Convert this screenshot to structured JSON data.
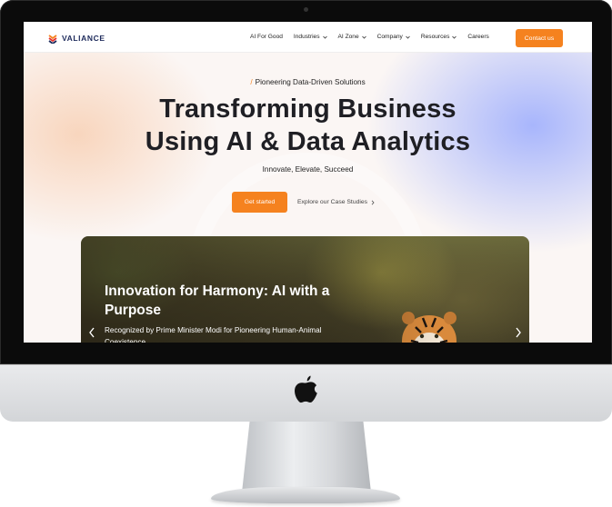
{
  "nav": {
    "brand": "VALIANCE",
    "items": [
      {
        "label": "AI For Good",
        "dropdown": false
      },
      {
        "label": "Industries",
        "dropdown": true
      },
      {
        "label": "AI Zone",
        "dropdown": true
      },
      {
        "label": "Company",
        "dropdown": true
      },
      {
        "label": "Resources",
        "dropdown": true
      },
      {
        "label": "Careers",
        "dropdown": false
      }
    ],
    "contact_label": "Contact us"
  },
  "hero": {
    "tagline": "Pioneering Data-Driven Solutions",
    "headline_line1": "Transforming Business",
    "headline_line2": "Using AI & Data Analytics",
    "subhead": "Innovate, Elevate, Succeed",
    "primary_cta": "Get started",
    "secondary_cta": "Explore our Case Studies"
  },
  "slider": {
    "title": "Innovation for Harmony: AI with a Purpose",
    "description": "Recognized by Prime Minister Modi for Pioneering Human-Animal Coexistence"
  },
  "colors": {
    "accent": "#f5821f",
    "brand_navy": "#1d2a5b",
    "headline": "#1f1f24"
  },
  "icons": {
    "logo": "valiance-chevron-logo",
    "apple": "apple-icon"
  }
}
